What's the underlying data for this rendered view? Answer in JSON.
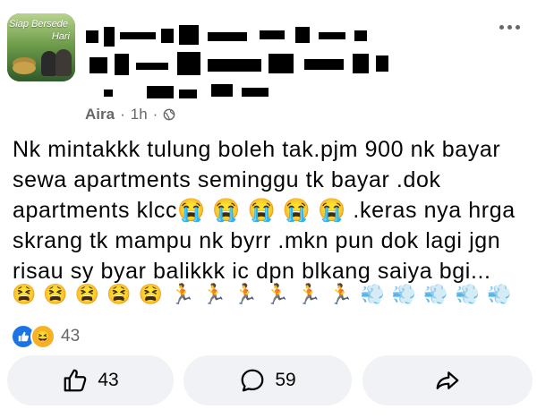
{
  "avatar": {
    "caption_line1": "Siap Bersede",
    "caption_line2": "Hari"
  },
  "post_meta": {
    "author": "Aira",
    "separator": "·",
    "time": "1h",
    "separator2": "·"
  },
  "post": {
    "lines": [
      "Nk mintakkk tulung boleh tak.pjm 900 nk bayar",
      "sewa apartments seminggu tk bayar .dok",
      "apartments klcc😭 😭 😭 😭 😭 .keras nya hrga",
      "skrang tk mampu nk byrr .mkn pun dok lagi jgn",
      "risau sy byar balikkk ic dpn blkang saiya bgi..."
    ],
    "emoji_row": [
      "😫",
      "😫",
      "😫",
      "😫",
      "😫",
      "🏃",
      "🏃",
      "🏃",
      "🏃",
      "🏃",
      "🏃",
      "💨",
      "💨",
      "💨",
      "💨",
      "💨",
      "💨"
    ]
  },
  "reactions": {
    "count": "43",
    "icons": [
      "like-icon",
      "haha-icon"
    ]
  },
  "actions": {
    "like_count": "43",
    "comment_count": "59"
  },
  "colors": {
    "accent": "#1b74e4",
    "muted": "#65676b",
    "button_bg": "#f0f2f5"
  }
}
